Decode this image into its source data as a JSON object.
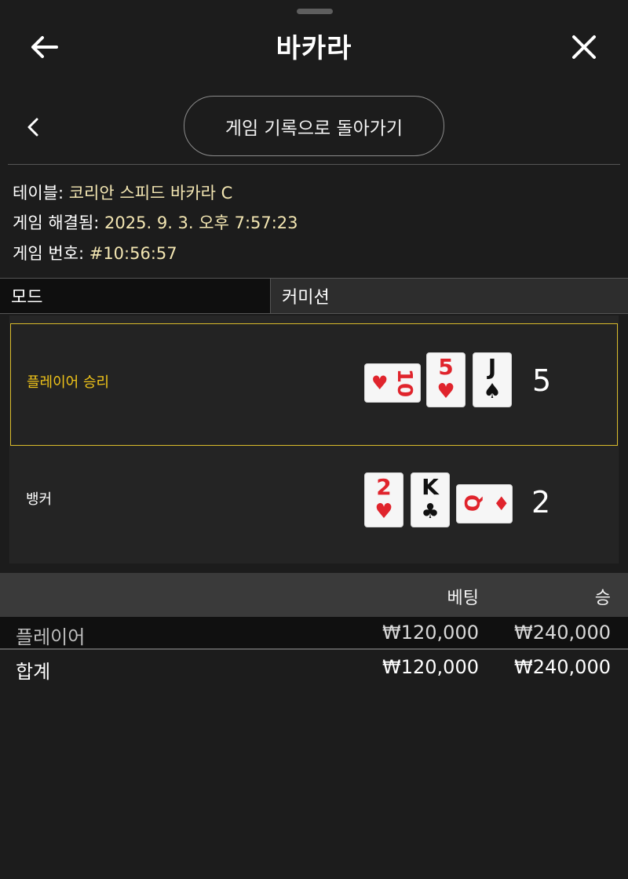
{
  "header": {
    "title": "바카라"
  },
  "back_to_history_label": "게임 기록으로 돌아가기",
  "info": {
    "table_label": "테이블:",
    "table_value": "코리안 스피드 바카라 C",
    "resolved_label": "게임 해결됨:",
    "resolved_value": "2025. 9. 3. 오후 7:57:23",
    "number_label": "게임 번호:",
    "number_value": "#10:56:57"
  },
  "mode": {
    "label": "모드",
    "value": "커미션"
  },
  "results": {
    "player": {
      "label": "플레이어 승리",
      "score": "5",
      "cards": [
        {
          "rank": "10",
          "suit": "♥",
          "color": "#e0242c",
          "orientation": "horizontal"
        },
        {
          "rank": "5",
          "suit": "♥",
          "color": "#e0242c",
          "orientation": "vertical"
        },
        {
          "rank": "J",
          "suit": "♠",
          "color": "#111111",
          "orientation": "vertical"
        }
      ]
    },
    "banker": {
      "label": "뱅커",
      "score": "2",
      "cards": [
        {
          "rank": "2",
          "suit": "♥",
          "color": "#e0242c",
          "orientation": "vertical"
        },
        {
          "rank": "K",
          "suit": "♣",
          "color": "#111111",
          "orientation": "vertical"
        },
        {
          "rank": "Q",
          "suit": "♦",
          "color": "#e0242c",
          "orientation": "horizontal"
        }
      ]
    }
  },
  "bets_table": {
    "headers": {
      "bet": "베팅",
      "win": "승"
    },
    "rows": [
      {
        "name": "플레이어",
        "bet": "₩120,000",
        "win": "₩240,000"
      }
    ],
    "total": {
      "name": "합계",
      "bet": "₩120,000",
      "win": "₩240,000"
    }
  },
  "colors": {
    "accent": "#d9bb2b",
    "value_text": "#f3e6b2",
    "winner_label": "#f0c419",
    "background": "#1c1c1c"
  }
}
